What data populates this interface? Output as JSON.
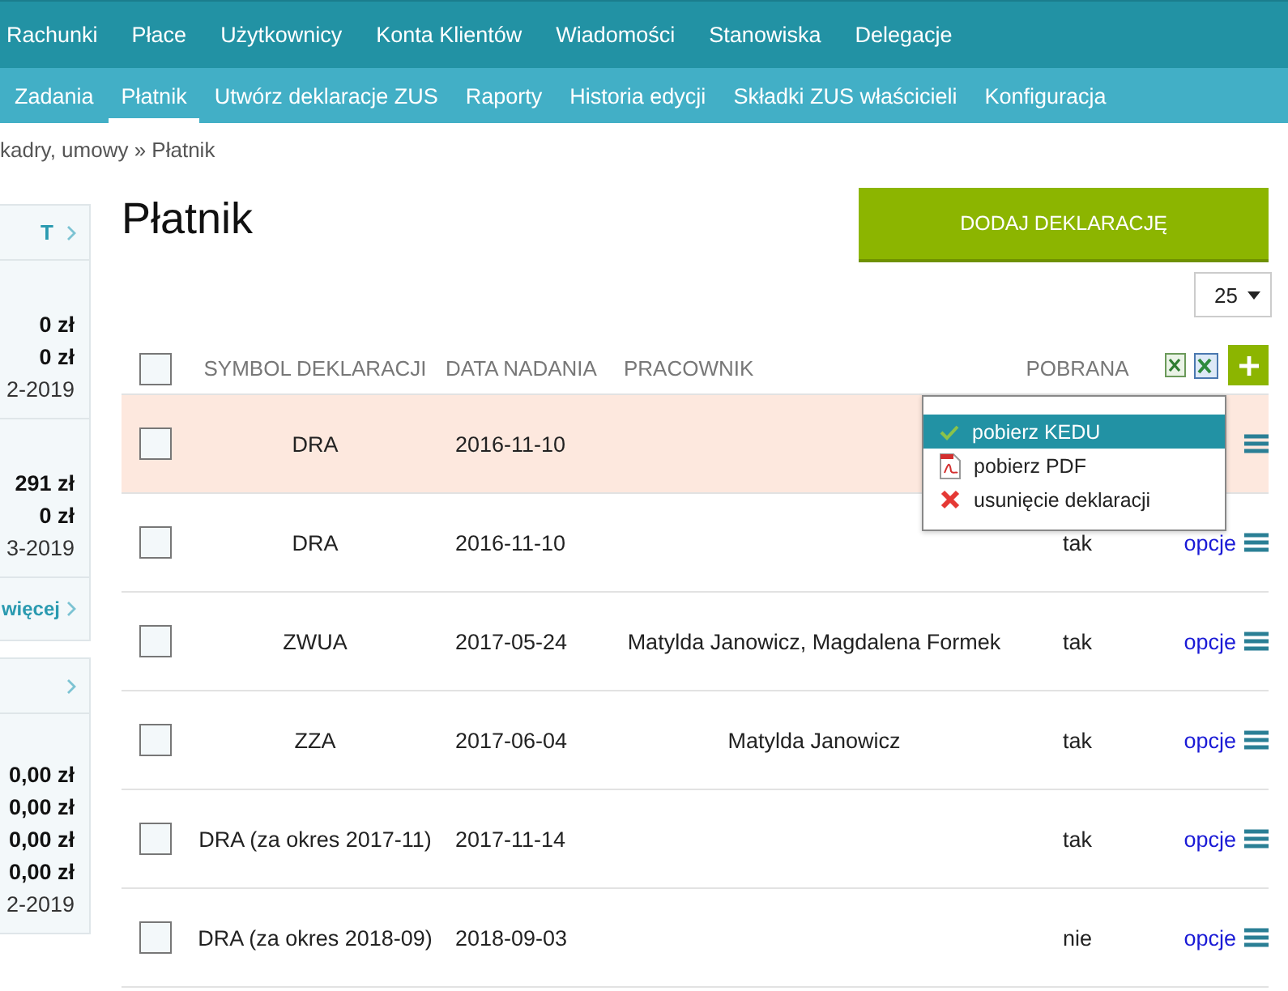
{
  "main_nav": [
    {
      "label": "Rachunki"
    },
    {
      "label": "Płace"
    },
    {
      "label": "Użytkownicy"
    },
    {
      "label": "Konta Klientów"
    },
    {
      "label": "Wiadomości"
    },
    {
      "label": "Stanowiska"
    },
    {
      "label": "Delegacje"
    }
  ],
  "sub_nav": [
    {
      "label": "Zadania",
      "selected": false
    },
    {
      "label": "Płatnik",
      "selected": true
    },
    {
      "label": "Utwórz deklaracje ZUS",
      "selected": false
    },
    {
      "label": "Raporty",
      "selected": false
    },
    {
      "label": "Historia edycji",
      "selected": false
    },
    {
      "label": "Składki ZUS właścicieli",
      "selected": false
    },
    {
      "label": "Konfiguracja",
      "selected": false
    }
  ],
  "breadcrumb": "kadry, umowy » Płatnik",
  "sidebar": [
    {
      "header": "T",
      "sections": [
        [
          "0 zł",
          "0 zł",
          "2-2019"
        ],
        [
          "291 zł",
          "0 zł",
          "3-2019"
        ]
      ],
      "footer_link": "więcej"
    },
    {
      "sections": [
        [
          "0,00 zł",
          "0,00 zł",
          "0,00 zł",
          "0,00 zł",
          "2-2019"
        ]
      ]
    }
  ],
  "page_title": "Płatnik",
  "add_button": "DODAJ DEKLARACJĘ",
  "page_size": "25",
  "table": {
    "select_all_checked": false,
    "columns": [
      "SYMBOL DEKLARACJI",
      "DATA NADANIA",
      "PRACOWNIK",
      "POBRANA"
    ],
    "rows": [
      {
        "symbol": "DRA",
        "date": "2016-11-10",
        "employee": "",
        "downloaded": "",
        "options": "",
        "selected": true,
        "checked": false
      },
      {
        "symbol": "DRA",
        "date": "2016-11-10",
        "employee": "",
        "downloaded": "tak",
        "options": "opcje",
        "selected": false,
        "checked": false
      },
      {
        "symbol": "ZWUA",
        "date": "2017-05-24",
        "employee": "Matylda Janowicz, Magdalena Formek",
        "downloaded": "tak",
        "options": "opcje",
        "selected": false,
        "checked": false
      },
      {
        "symbol": "ZZA",
        "date": "2017-06-04",
        "employee": "Matylda Janowicz",
        "downloaded": "tak",
        "options": "opcje",
        "selected": false,
        "checked": false
      },
      {
        "symbol": "DRA (za okres 2017-11)",
        "date": "2017-11-14",
        "employee": "",
        "downloaded": "tak",
        "options": "opcje",
        "selected": false,
        "checked": false
      },
      {
        "symbol": "DRA (za okres 2018-09)",
        "date": "2018-09-03",
        "employee": "",
        "downloaded": "nie",
        "options": "opcje",
        "selected": false,
        "checked": false
      }
    ]
  },
  "options_menu": [
    {
      "label": "pobierz KEDU",
      "kind": "check",
      "selected": true
    },
    {
      "label": "pobierz PDF",
      "kind": "pdf",
      "selected": false
    },
    {
      "label": "usunięcie deklaracji",
      "kind": "delete",
      "selected": false
    }
  ]
}
